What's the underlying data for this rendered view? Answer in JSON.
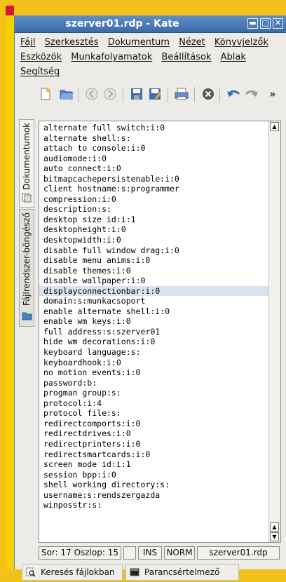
{
  "window": {
    "title": "szerver01.rdp - Kate"
  },
  "window_controls": [
    "minimize",
    "maximize",
    "close"
  ],
  "menu": {
    "row1": [
      {
        "label": "Fájl",
        "key": "file"
      },
      {
        "label": "Szerkesztés",
        "key": "edit"
      },
      {
        "label": "Dokumentum",
        "key": "document"
      },
      {
        "label": "Nézet",
        "key": "view"
      },
      {
        "label": "Könyvjelzők",
        "key": "bookmarks"
      }
    ],
    "row2": [
      {
        "label": "Eszközök",
        "key": "tools"
      },
      {
        "label": "Munkafolyamatok",
        "key": "sessions"
      },
      {
        "label": "Beállítások",
        "key": "settings"
      },
      {
        "label": "Ablak",
        "key": "window"
      }
    ],
    "row3": [
      {
        "label": "Segítség",
        "key": "help"
      }
    ]
  },
  "toolbar": {
    "icons": [
      "new-document-icon",
      "open-folder-icon",
      "back-icon",
      "forward-icon",
      "save-icon",
      "save-as-icon",
      "print-icon",
      "close-document-icon",
      "undo-icon",
      "redo-icon"
    ],
    "overflow": "»"
  },
  "side_tabs": {
    "documents": "Dokumentumok",
    "filesystem": "Fájlrendszer-böngésző"
  },
  "editor": {
    "highlighted_line": 17,
    "lines": [
      "alternate full switch:i:0",
      "alternate shell:s:",
      "attach to console:i:0",
      "audiomode:i:0",
      "auto connect:i:0",
      "bitmapcachepersistenable:i:0",
      "client hostname:s:programmer",
      "compression:i:0",
      "description:s:",
      "desktop size id:i:1",
      "desktopheight:i:0",
      "desktopwidth:i:0",
      "disable full window drag:i:0",
      "disable menu anims:i:0",
      "disable themes:i:0",
      "disable wallpaper:i:0",
      "displayconnectionbar:i:0",
      "domain:s:munkacsoport",
      "enable alternate shell:i:0",
      "enable wm keys:i:0",
      "full address:s:szerver01",
      "hide wm decorations:i:0",
      "keyboard language:s:",
      "keyboardhook:i:0",
      "no motion events:i:0",
      "password:b:",
      "progman group:s:",
      "protocol:i:4",
      "protocol file:s:",
      "redirectcomports:i:0",
      "redirectdrives:i:0",
      "redirectprinters:i:0",
      "redirectsmartcards:i:0",
      "screen mode id:i:1",
      "session bpp:i:0",
      "shell working directory:s:",
      "username:s:rendszergazda",
      "winposstr:s:"
    ]
  },
  "status": {
    "position": "Sor: 17 Oszlop: 15",
    "blank": "",
    "ins": "INS",
    "norm": "NORM",
    "filename": "szerver01.rdp"
  },
  "bottom_tabs": {
    "find_in_files": "Keresés fájlokban",
    "terminal": "Parancsértelmező"
  },
  "colors": {
    "titlebar": "#4a7ab8",
    "highlight_line": "#d9e4f2",
    "desktop": "#f3c21a"
  }
}
